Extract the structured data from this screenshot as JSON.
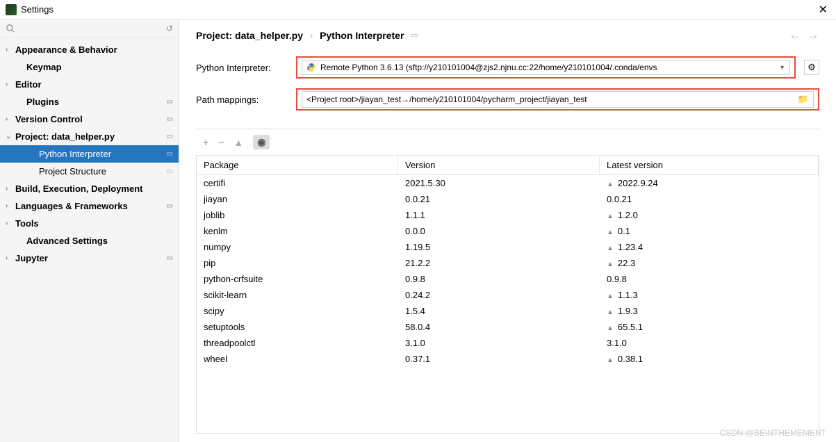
{
  "window": {
    "title": "Settings"
  },
  "search": {
    "placeholder": ""
  },
  "sidebar": {
    "items": [
      {
        "label": "Appearance & Behavior",
        "chevron": "›",
        "bold": true,
        "indent": 0
      },
      {
        "label": "Keymap",
        "chevron": "",
        "bold": true,
        "indent": 1
      },
      {
        "label": "Editor",
        "chevron": "›",
        "bold": true,
        "indent": 0
      },
      {
        "label": "Plugins",
        "chevron": "",
        "bold": true,
        "indent": 1,
        "badge": "▭"
      },
      {
        "label": "Version Control",
        "chevron": "›",
        "bold": true,
        "indent": 0,
        "badge": "▭"
      },
      {
        "label": "Project: data_helper.py",
        "chevron": "⌄",
        "bold": true,
        "indent": 0,
        "badge": "▭"
      },
      {
        "label": "Python Interpreter",
        "chevron": "",
        "bold": false,
        "indent": 2,
        "selected": true,
        "badge": "▭"
      },
      {
        "label": "Project Structure",
        "chevron": "",
        "bold": false,
        "indent": 2,
        "badge": "▭"
      },
      {
        "label": "Build, Execution, Deployment",
        "chevron": "›",
        "bold": true,
        "indent": 0
      },
      {
        "label": "Languages & Frameworks",
        "chevron": "›",
        "bold": true,
        "indent": 0,
        "badge": "▭"
      },
      {
        "label": "Tools",
        "chevron": "›",
        "bold": true,
        "indent": 0
      },
      {
        "label": "Advanced Settings",
        "chevron": "",
        "bold": true,
        "indent": 1
      },
      {
        "label": "Jupyter",
        "chevron": "›",
        "bold": true,
        "indent": 0,
        "badge": "▭"
      }
    ]
  },
  "breadcrumb": {
    "project_prefix": "Project:",
    "project_name": "data_helper.py",
    "page": "Python Interpreter"
  },
  "fields": {
    "interpreter_label": "Python Interpreter:",
    "interpreter_value": "Remote Python 3.6.13 (sftp://y210101004@zjs2.njnu.cc:22/home/y210101004/.conda/envs",
    "mappings_label": "Path mappings:",
    "mappings_value": "<Project root>/jiayan_test→/home/y210101004/pycharm_project/jiayan_test"
  },
  "table": {
    "headers": {
      "package": "Package",
      "version": "Version",
      "latest": "Latest version"
    },
    "rows": [
      {
        "pkg": "certifi",
        "ver": "2021.5.30",
        "lat": "2022.9.24",
        "up": true
      },
      {
        "pkg": "jiayan",
        "ver": "0.0.21",
        "lat": "0.0.21",
        "up": false
      },
      {
        "pkg": "joblib",
        "ver": "1.1.1",
        "lat": "1.2.0",
        "up": true
      },
      {
        "pkg": "kenlm",
        "ver": "0.0.0",
        "lat": "0.1",
        "up": true
      },
      {
        "pkg": "numpy",
        "ver": "1.19.5",
        "lat": "1.23.4",
        "up": true
      },
      {
        "pkg": "pip",
        "ver": "21.2.2",
        "lat": "22.3",
        "up": true
      },
      {
        "pkg": "python-crfsuite",
        "ver": "0.9.8",
        "lat": "0.9.8",
        "up": false
      },
      {
        "pkg": "scikit-learn",
        "ver": "0.24.2",
        "lat": "1.1.3",
        "up": true
      },
      {
        "pkg": "scipy",
        "ver": "1.5.4",
        "lat": "1.9.3",
        "up": true
      },
      {
        "pkg": "setuptools",
        "ver": "58.0.4",
        "lat": "65.5.1",
        "up": true
      },
      {
        "pkg": "threadpoolctl",
        "ver": "3.1.0",
        "lat": "3.1.0",
        "up": false
      },
      {
        "pkg": "wheel",
        "ver": "0.37.1",
        "lat": "0.38.1",
        "up": true
      }
    ]
  },
  "watermark": "CSDN @BEINTHEMEMENT"
}
